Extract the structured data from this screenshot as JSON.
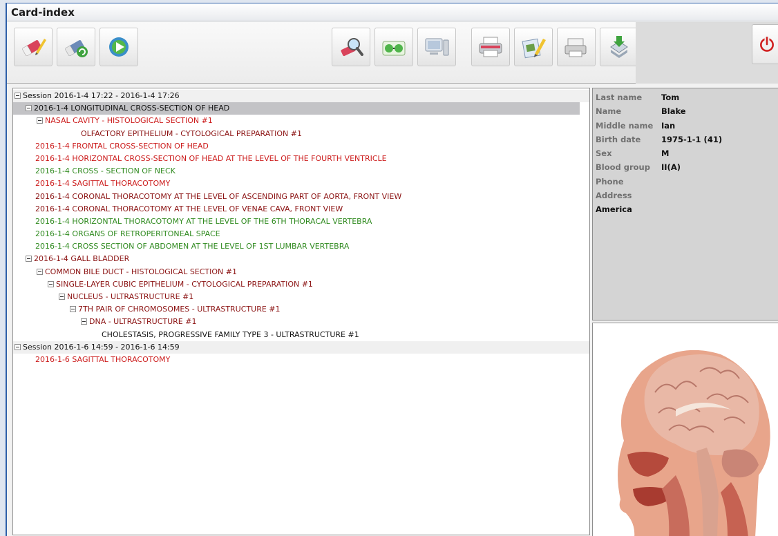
{
  "window": {
    "title": "Card-index"
  },
  "toolbar": {
    "buttons": [
      {
        "name": "eraser-edit-icon"
      },
      {
        "name": "eraser-refresh-icon"
      },
      {
        "name": "play-forward-icon"
      },
      {
        "name": "magnifier-search-icon"
      },
      {
        "name": "glasses-view-icon"
      },
      {
        "name": "monitor-display-icon"
      },
      {
        "name": "printer-icon"
      },
      {
        "name": "edit-report-icon"
      },
      {
        "name": "print-preview-icon"
      },
      {
        "name": "download-export-icon"
      },
      {
        "name": "power-exit-icon"
      }
    ]
  },
  "tree": [
    {
      "text": "Session 2016-1-4 17:22 - 2016-1-4 17:26",
      "level": 0,
      "toggle": true,
      "color": "black",
      "session": true
    },
    {
      "text": "2016-1-4  LONGITUDINAL CROSS-SECTION OF HEAD",
      "level": 1,
      "toggle": true,
      "color": "black",
      "selected": true
    },
    {
      "text": "NASAL CAVITY - HISTOLOGICAL SECTION #1",
      "level": 2,
      "toggle": true,
      "color": "red"
    },
    {
      "text": "OLFACTORY EPITHELIUM - CYTOLOGICAL PREPARATION #1",
      "level": 3,
      "toggle": false,
      "color": "dark"
    },
    {
      "text": "2016-1-4  FRONTAL CROSS-SECTION OF HEAD",
      "level": 1,
      "toggle": false,
      "color": "red"
    },
    {
      "text": "2016-1-4  HORIZONTAL CROSS-SECTION OF HEAD AT THE LEVEL OF THE FOURTH VENTRICLE",
      "level": 1,
      "toggle": false,
      "color": "red"
    },
    {
      "text": "2016-1-4  CROSS - SECTION OF NECK",
      "level": 1,
      "toggle": false,
      "color": "green"
    },
    {
      "text": "2016-1-4  SAGITTAL THORACOTOMY",
      "level": 1,
      "toggle": false,
      "color": "red"
    },
    {
      "text": "2016-1-4  CORONAL THORACOTOMY AT THE LEVEL OF ASCENDING PART OF AORTA, FRONT VIEW",
      "level": 1,
      "toggle": false,
      "color": "dark"
    },
    {
      "text": "2016-1-4  CORONAL THORACOTOMY AT THE LEVEL OF VENAE CAVA, FRONT VIEW",
      "level": 1,
      "toggle": false,
      "color": "dark"
    },
    {
      "text": "2016-1-4  HORIZONTAL THORACOTOMY AT THE LEVEL OF THE 6TH THORACAL VERTEBRA",
      "level": 1,
      "toggle": false,
      "color": "green"
    },
    {
      "text": "2016-1-4  ORGANS OF RETROPERITONEAL SPACE",
      "level": 1,
      "toggle": false,
      "color": "green"
    },
    {
      "text": "2016-1-4  CROSS SECTION OF ABDOMEN AT THE LEVEL OF 1ST LUMBAR VERTEBRA",
      "level": 1,
      "toggle": false,
      "color": "green"
    },
    {
      "text": "2016-1-4  GALL BLADDER",
      "level": 1,
      "toggle": true,
      "color": "dark"
    },
    {
      "text": "COMMON BILE DUCT - HISTOLOGICAL SECTION #1",
      "level": 2,
      "toggle": true,
      "color": "dark"
    },
    {
      "text": "SINGLE-LAYER CUBIC EPITHELIUM - CYTOLOGICAL PREPARATION #1",
      "level": 3,
      "toggle": true,
      "color": "dark"
    },
    {
      "text": "NUCLEUS - ULTRASTRUCTURE #1",
      "level": 4,
      "toggle": true,
      "color": "dark"
    },
    {
      "text": "7TH PAIR OF CHROMOSOMES - ULTRASTRUCTURE #1",
      "level": 5,
      "toggle": true,
      "color": "dark"
    },
    {
      "text": "DNA - ULTRASTRUCTURE #1",
      "level": 6,
      "toggle": true,
      "color": "dark"
    },
    {
      "text": "CHOLESTASIS, PROGRESSIVE FAMILY TYPE 3 - ULTRASTRUCTURE #1",
      "level": 7,
      "toggle": false,
      "color": "black"
    },
    {
      "text": "Session 2016-1-6 14:59 - 2016-1-6 14:59",
      "level": 0,
      "toggle": true,
      "color": "black",
      "session": true
    },
    {
      "text": "2016-1-6  SAGITTAL THORACOTOMY",
      "level": 1,
      "toggle": false,
      "color": "red"
    }
  ],
  "patient": {
    "rows": [
      {
        "label": "Last name",
        "value": "Tom"
      },
      {
        "label": "Name",
        "value": "Blake"
      },
      {
        "label": "Middle name",
        "value": "Ian"
      },
      {
        "label": "Birth date",
        "value": "1975-1-1 (41)"
      },
      {
        "label": "Sex",
        "value": "M"
      },
      {
        "label": "Blood group",
        "value": "II(A)"
      },
      {
        "label": "Phone",
        "value": ""
      },
      {
        "label": "Address",
        "value": ""
      }
    ],
    "country": "America"
  },
  "colors": {
    "red": "#cc1b1b",
    "dark": "#8b1212",
    "green": "#2f8a1f",
    "black": "#111111",
    "selected_row": "#c3c3c6"
  }
}
